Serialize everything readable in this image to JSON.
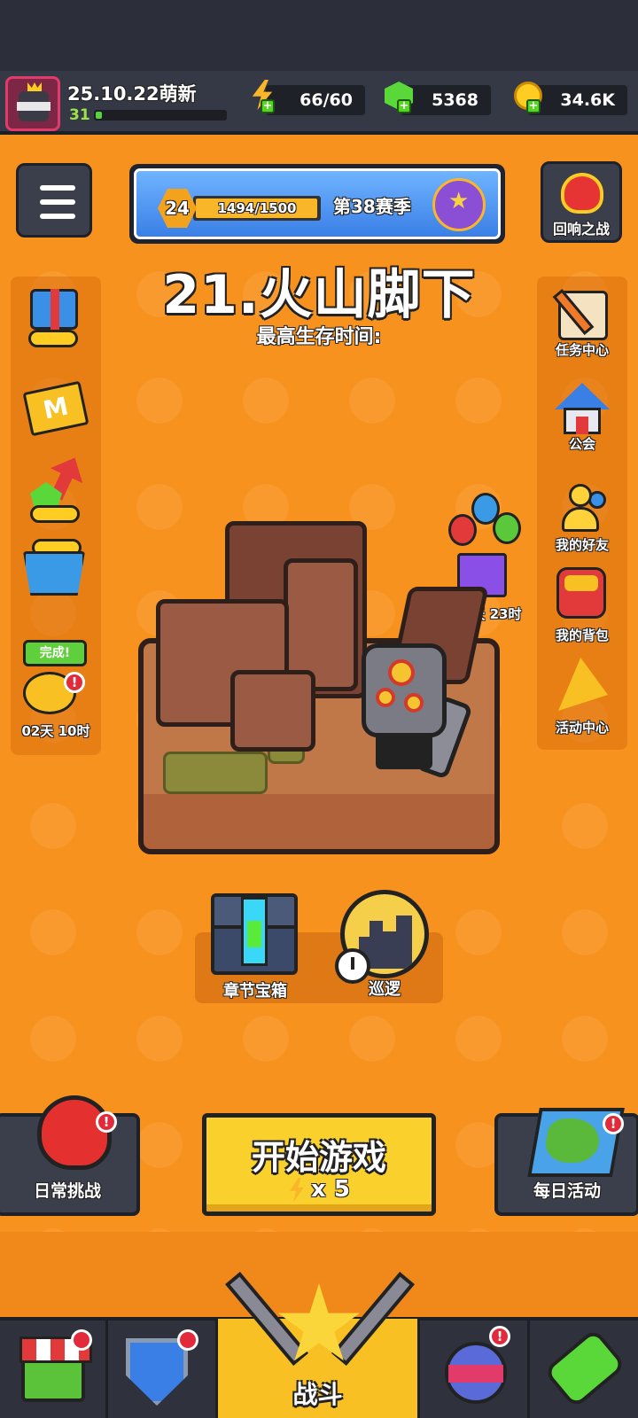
{
  "player": {
    "name": "25.10.22萌新",
    "level": "31",
    "xp_fraction": 0.05
  },
  "resources": {
    "energy": "66/60",
    "gems": "5368",
    "coins": "34.6K"
  },
  "season": {
    "level": "24",
    "progress_text": "1494/1500",
    "progress_fraction": 0.996,
    "name": "第38赛季"
  },
  "top_right_button": "回响之战",
  "stage": {
    "title": "21.火山脚下",
    "survival_label": "最高生存时间:"
  },
  "left_panel": {
    "piggy_done": "完成!",
    "piggy_timer": "02天 10时"
  },
  "balloon_gift_timer": "02天 23时",
  "right_panel": {
    "items": [
      "任务中心",
      "公会",
      "我的好友",
      "我的背包",
      "活动中心"
    ]
  },
  "chapter_chest_label": "章节宝箱",
  "patrol_label": "巡逻",
  "daily_challenge_label": "日常挑战",
  "daily_event_label": "每日活动",
  "start_button": {
    "title": "开始游戏",
    "cost": "x 5"
  },
  "nav": {
    "battle_label": "战斗"
  },
  "badge": "!",
  "colors": {
    "background": "#f7921e",
    "panel": "#3b3f4c",
    "start_button": "#fad12c",
    "badge": "#e32a3a"
  }
}
